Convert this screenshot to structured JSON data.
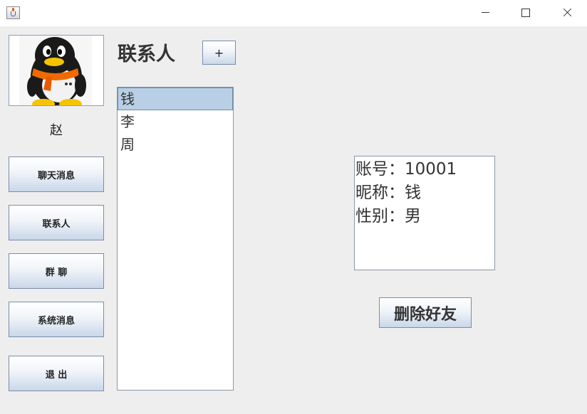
{
  "window": {
    "icon": "java-cup-icon",
    "controls": [
      "minimize-icon",
      "maximize-icon",
      "close-icon"
    ]
  },
  "user": {
    "avatar": "penguin-avatar",
    "name": "赵"
  },
  "nav": {
    "chat_messages": "聊天消息",
    "contacts": "联系人",
    "group_chat": "群 聊",
    "system_messages": "系统消息",
    "exit": "退 出"
  },
  "contacts_panel": {
    "title": "联系人",
    "add_label": "+",
    "items": [
      {
        "name": "钱",
        "selected": true
      },
      {
        "name": "李",
        "selected": false
      },
      {
        "name": "周",
        "selected": false
      }
    ]
  },
  "details": {
    "account": "账号：10001",
    "nickname": "昵称：钱",
    "gender": "性别：男"
  },
  "actions": {
    "delete_friend": "删除好友"
  },
  "colors": {
    "background": "#eeeeee",
    "selection": "#b8cfe5",
    "button_gradient_bottom": "#c9d7ea"
  }
}
